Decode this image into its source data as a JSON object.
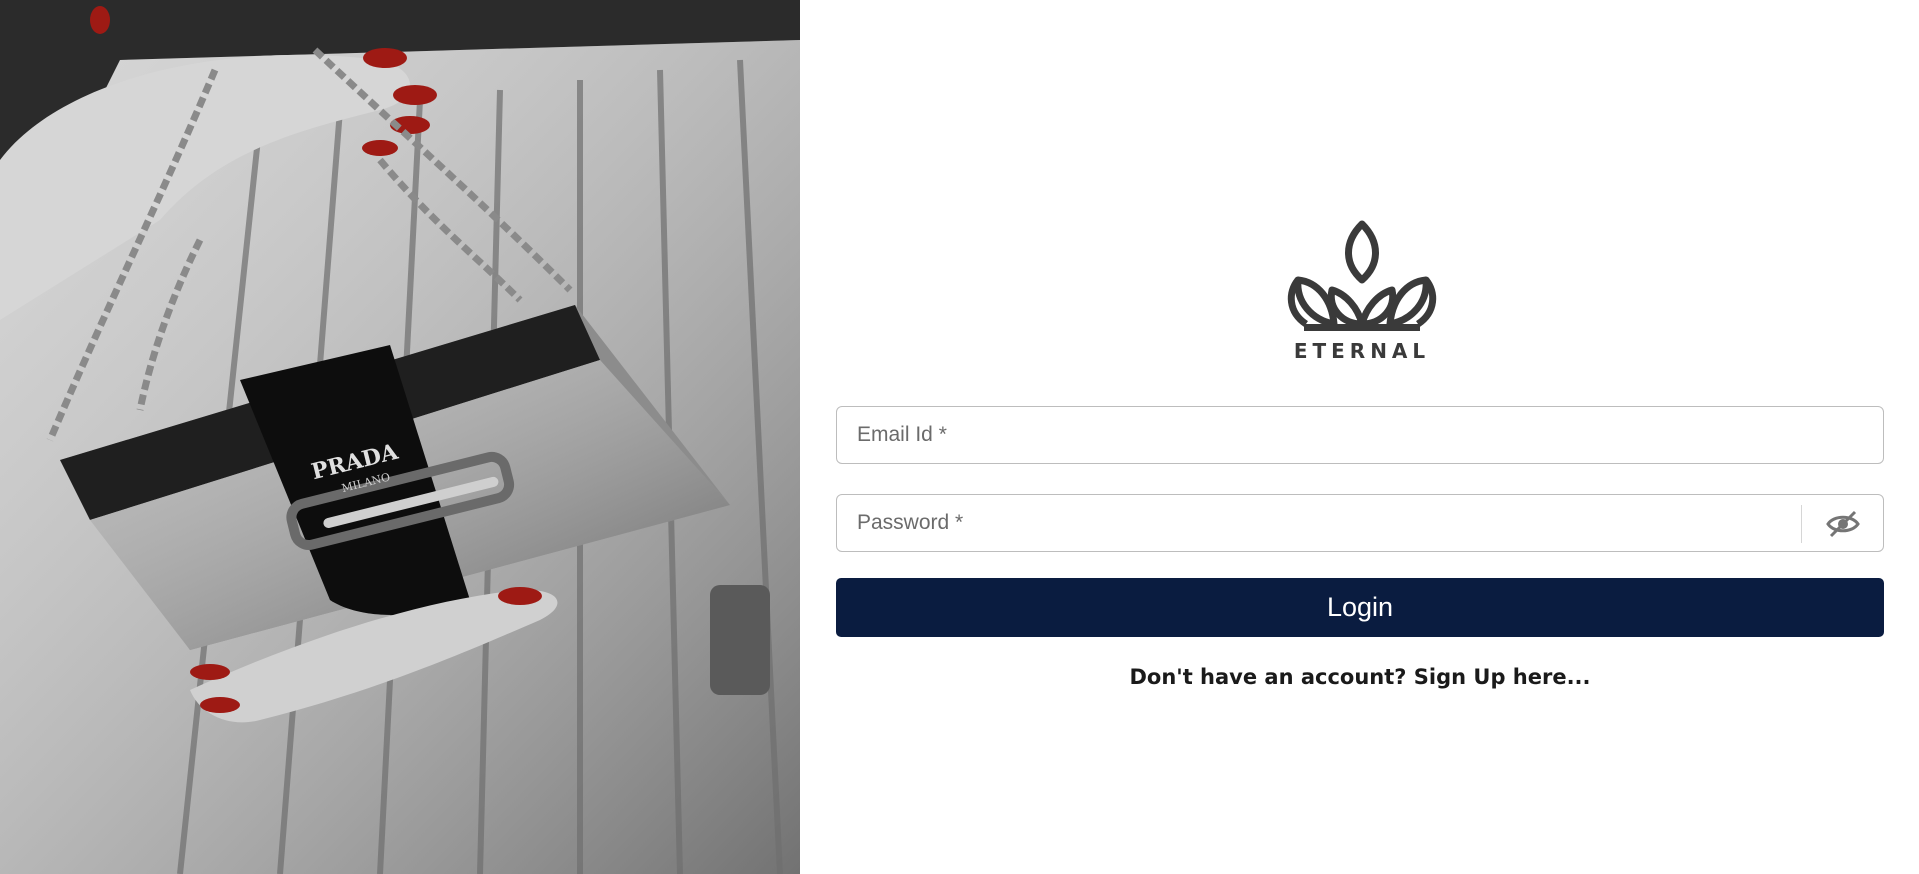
{
  "brand": {
    "name": "ETERNAL",
    "logo_icon": "crown-icon"
  },
  "photo": {
    "description_icon": "handbag-photo",
    "bag_brand": "PRADA",
    "bag_sub": "MILANO"
  },
  "form": {
    "email": {
      "placeholder": "Email Id *",
      "value": ""
    },
    "password": {
      "placeholder": "Password *",
      "value": "",
      "toggle_icon": "eye-off-icon"
    },
    "login_label": "Login",
    "signup_text": "Don't have an account? Sign Up here..."
  },
  "colors": {
    "button_bg": "#0a1c40",
    "logo": "#3a3a3a",
    "border": "#bdbdbd"
  }
}
